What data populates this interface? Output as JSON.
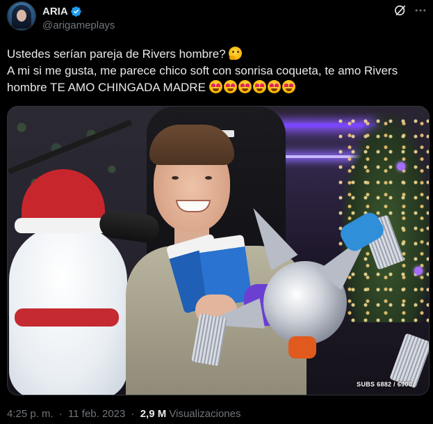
{
  "author": {
    "display_name": "ARIA",
    "handle": "@arigameplays",
    "avatar_icon": "profile-avatar",
    "verified_icon": "verified-badge-icon",
    "verified_color": "#1d9bf0"
  },
  "header_actions": {
    "grok_icon": "grok-icon",
    "more_icon": "more-options-icon"
  },
  "tweet": {
    "line1": "Ustedes serían pareja de Rivers hombre?",
    "line1_emoji": "thinking-face-emoji",
    "line2": "A mi si me gusta, me parece chico soft con sonrisa coqueta, te amo Rivers hombre TE AMO CHINGADA MADRE",
    "line2_emoji": "heart-eyes-emoji",
    "line2_emoji_count": 6
  },
  "media": {
    "overlay_text": "SUBS 6882 / 6900"
  },
  "footer": {
    "time": "4:25 p. m.",
    "dot1": "·",
    "date": "11 feb. 2023",
    "dot2": "·",
    "views_count": "2,9 M",
    "views_label": "Visualizaciones"
  },
  "colors": {
    "background": "#000000",
    "text_primary": "#e7e9ea",
    "text_secondary": "#71767b"
  }
}
